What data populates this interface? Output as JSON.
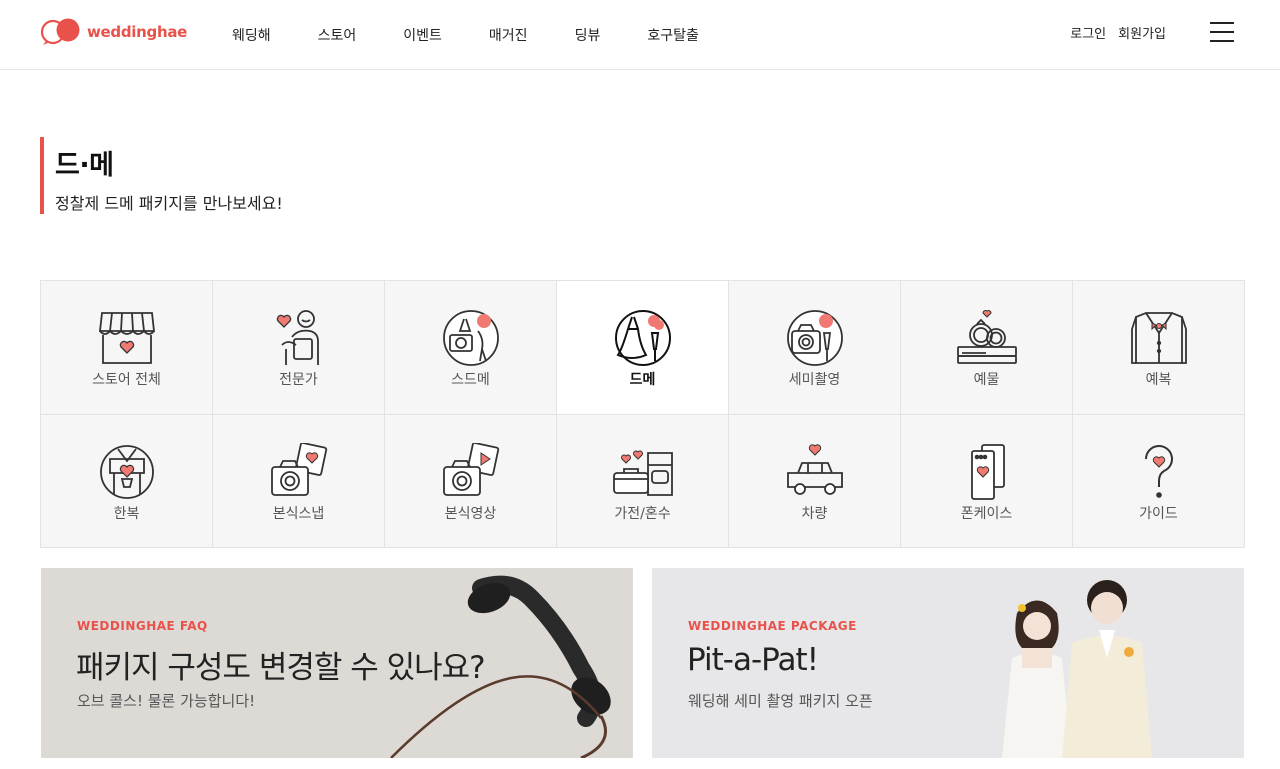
{
  "brand": {
    "name": "weddinghae",
    "color": "#e8524a"
  },
  "nav": [
    {
      "label": "웨딩해"
    },
    {
      "label": "스토어"
    },
    {
      "label": "이벤트"
    },
    {
      "label": "매거진"
    },
    {
      "label": "딩뷰"
    },
    {
      "label": "호구탈출"
    }
  ],
  "util": {
    "login": "로그인",
    "signup": "회원가입"
  },
  "page": {
    "title": "드·메",
    "subtitle": "정찰제 드메 패키지를 만나보세요!"
  },
  "categories": [
    {
      "label": "스토어 전체",
      "icon": "store-icon"
    },
    {
      "label": "전문가",
      "icon": "expert-icon"
    },
    {
      "label": "스드메",
      "icon": "studio-dress-makeup-icon"
    },
    {
      "label": "드메",
      "icon": "dress-makeup-icon",
      "active": true
    },
    {
      "label": "세미촬영",
      "icon": "camera-icon"
    },
    {
      "label": "예물",
      "icon": "rings-icon"
    },
    {
      "label": "예복",
      "icon": "suit-icon"
    },
    {
      "label": "한복",
      "icon": "hanbok-icon"
    },
    {
      "label": "본식스냅",
      "icon": "snap-photo-icon"
    },
    {
      "label": "본식영상",
      "icon": "video-icon"
    },
    {
      "label": "가전/혼수",
      "icon": "appliance-icon"
    },
    {
      "label": "차량",
      "icon": "car-icon"
    },
    {
      "label": "폰케이스",
      "icon": "phone-case-icon"
    },
    {
      "label": "가이드",
      "icon": "guide-icon"
    }
  ],
  "banners": [
    {
      "kicker": "WEDDINGHAE FAQ",
      "headline": "패키지 구성도 변경할 수 있나요?",
      "desc": "오브 콜스! 물론 가능합니다!"
    },
    {
      "kicker": "WEDDINGHAE PACKAGE",
      "headline": "Pit-a-Pat!",
      "desc": "웨딩해 세미 촬영 패키지 오픈"
    }
  ]
}
